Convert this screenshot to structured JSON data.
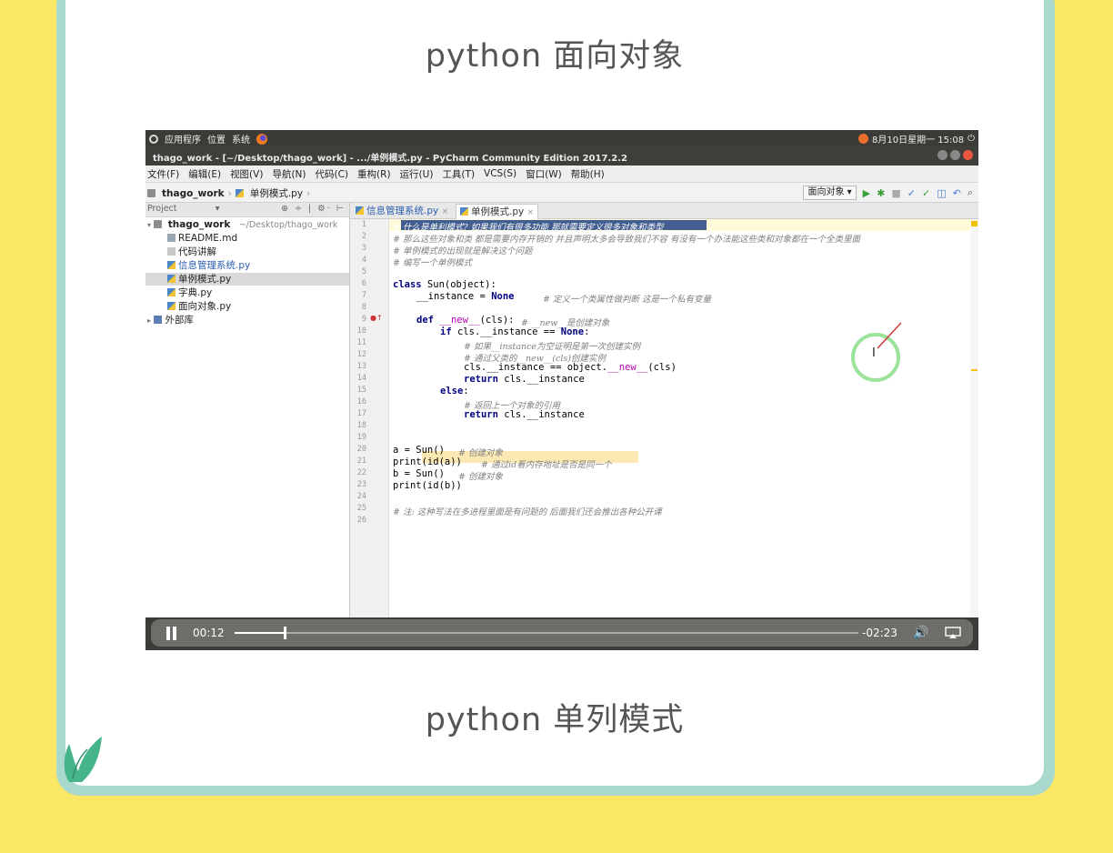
{
  "page": {
    "title": "python 面向对象",
    "caption": "python 单列模式"
  },
  "system_bar": {
    "menu_items": [
      "应用程序",
      "位置",
      "系统"
    ],
    "clock": "8月10日星期一 15:08"
  },
  "window": {
    "title": "thago_work - [~/Desktop/thago_work] - .../单例模式.py - PyCharm Community Edition 2017.2.2"
  },
  "menu": [
    "文件(F)",
    "编辑(E)",
    "视图(V)",
    "导航(N)",
    "代码(C)",
    "重构(R)",
    "运行(U)",
    "工具(T)",
    "VCS(S)",
    "窗口(W)",
    "帮助(H)"
  ],
  "breadcrumb": [
    "thago_work",
    "单例模式.py"
  ],
  "run_config": "面向对象",
  "project_panel": {
    "header": "Project",
    "tree": [
      {
        "label": "thago_work",
        "hint": "~/Desktop/thago_work",
        "icon": "folder-icon"
      },
      {
        "label": "README.md",
        "icon": "markdown-file-icon"
      },
      {
        "label": "代码讲解",
        "icon": "text-file-icon"
      },
      {
        "label": "信息管理系统.py",
        "icon": "python-file-icon"
      },
      {
        "label": "单例模式.py",
        "icon": "python-file-icon",
        "selected": true
      },
      {
        "label": "字典.py",
        "icon": "python-file-icon"
      },
      {
        "label": "面向对象.py",
        "icon": "python-file-icon"
      },
      {
        "label": "外部库",
        "icon": "library-icon"
      }
    ]
  },
  "tabs": [
    {
      "label": "信息管理系统.py"
    },
    {
      "label": "单例模式.py",
      "active": true
    }
  ],
  "editor": {
    "line_numbers": [
      "1",
      "2",
      "3",
      "4",
      "5",
      "6",
      "7",
      "8",
      "9",
      "10",
      "11",
      "12",
      "13",
      "14",
      "15",
      "16",
      "17",
      "18",
      "19",
      "20",
      "21",
      "22",
      "23",
      "24",
      "25",
      "26"
    ],
    "comments": {
      "l1": "# 什么是单利模式? 如果我们有很多功能 那就需要定义很多对象和类型",
      "l2": "# 那么这些对象和类 都是需要内存开销的 并且声明太多会导致我们不容 有没有一个办法能这些类和对象都在一个全类里面",
      "l3": "# 单例模式的出现就是解决这个问题",
      "l4": "# 编写一个单例模式",
      "l7": "# 定义一个类属性做判断 这是一个私有变量",
      "l9": "# __new__是创建对象",
      "l11": "# 如果__instance为空证明是第一次创建实例",
      "l12": "# 通过父类的__new__(cls)创建实例",
      "l16": "# 返回上一个对象的引用",
      "l20": "# 创建对象",
      "l21": "# 通过id看内存地址是否是同一个",
      "l22": "# 创建对象",
      "l25": "# 注: 这种写法在多进程里面是有问题的 后面我们还会推出各种公开课"
    },
    "code": {
      "l6_kw": "class",
      "l6_rest": " Sun(object):",
      "l7_name": "__instance = ",
      "l7_val": "None",
      "l9_kw": "def",
      "l9_name": "__new__",
      "l9_rest": "(cls):",
      "l10_kw": "if",
      "l10_rest": " cls.__instance == ",
      "l10_val": "None",
      "l10_end": ":",
      "l13_a": "cls.__instance == object.",
      "l13_b": "__new__",
      "l13_c": "(cls)",
      "l14_kw": "return",
      "l14_rest": " cls.__instance",
      "l15_kw": "else",
      "l15_rest": ":",
      "l17_kw": "return",
      "l17_rest": " cls.__instance",
      "l20": "a = Sun()",
      "l21": "print(id(a))",
      "l22": "b = Sun()",
      "l23": "print(id(b))"
    }
  },
  "player": {
    "elapsed": "00:12",
    "remaining": "-02:23",
    "progress": 0.078
  }
}
